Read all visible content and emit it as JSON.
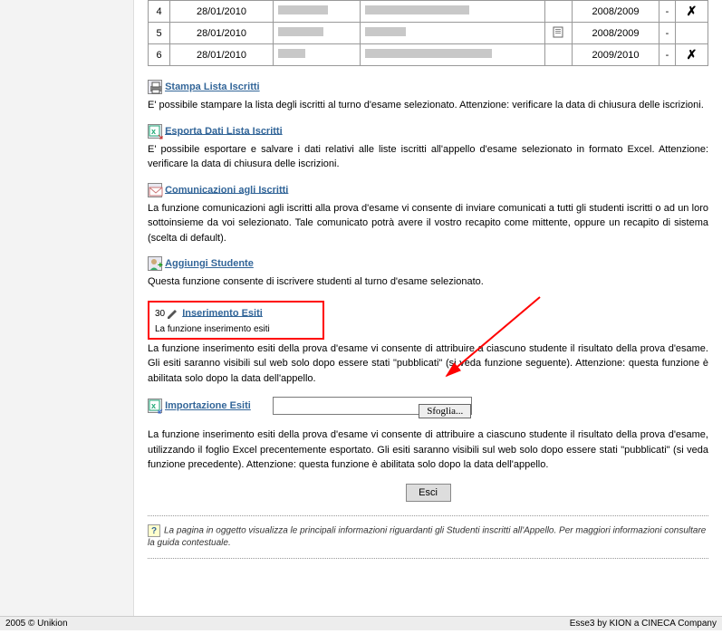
{
  "table": {
    "rows": [
      {
        "n": "4",
        "date": "28/01/2010",
        "year": "2008/2009",
        "dash": "-",
        "hasIcon": false,
        "hasX": true
      },
      {
        "n": "5",
        "date": "28/01/2010",
        "year": "2008/2009",
        "dash": "-",
        "hasIcon": true,
        "hasX": false
      },
      {
        "n": "6",
        "date": "28/01/2010",
        "year": "2009/2010",
        "dash": "-",
        "hasIcon": false,
        "hasX": true
      }
    ]
  },
  "sections": {
    "stampa": {
      "label": "Stampa Lista Iscritti",
      "desc": "E' possibile stampare la lista degli iscritti al turno d'esame selezionato. Attenzione: verificare la data di chiusura delle iscrizioni."
    },
    "esporta": {
      "label": "Esporta Dati Lista Iscritti",
      "desc": "E' possibile esportare e salvare i dati relativi alle liste iscritti all'appello d'esame selezionato in formato Excel. Attenzione: verificare la data di chiusura delle iscrizioni."
    },
    "comunica": {
      "label": "Comunicazioni agli Iscritti",
      "desc": "La funzione comunicazioni agli iscritti alla prova d'esame vi consente di inviare comunicati a tutti gli studenti iscritti o ad un loro sottoinsieme da voi selezionato. Tale comunicato potrà avere il vostro recapito come mittente, oppure un recapito di sistema (scelta di default)."
    },
    "aggiungi": {
      "label": "Aggiungi Studente",
      "desc": "Questa funzione consente di iscrivere studenti al turno d'esame selezionato."
    },
    "inserimento": {
      "prefix": "30",
      "label": "Inserimento Esiti",
      "desc": "La funzione inserimento esiti della prova d'esame vi consente di attribuire a ciascuno studente il risultato della prova d'esame. Gli esiti saranno visibili sul web solo dopo essere stati \"pubblicati\" (si veda funzione seguente). Attenzione: questa funzione è abilitata solo dopo la data dell'appello."
    },
    "importa": {
      "label": "Importazione Esiti",
      "browse": "Sfoglia...",
      "desc": "La funzione inserimento esiti della prova d'esame vi consente di attribuire a ciascuno studente il risultato della prova d'esame, utilizzando il foglio Excel precentemente esportato. Gli esiti saranno visibili sul web solo dopo essere stati \"pubblicati\" (si veda funzione precedente). Attenzione: questa funzione è abilitata solo dopo la data dell'appello."
    }
  },
  "esci": "Esci",
  "help_icon": "?",
  "help": "La pagina in oggetto visualizza le principali informazioni riguardanti gli Studenti inscritti all'Appello. Per maggiori informazioni consultare la guida contestuale.",
  "footer": {
    "left": "2005 © Unikion",
    "right": "Esse3 by KION a CINECA Company"
  }
}
